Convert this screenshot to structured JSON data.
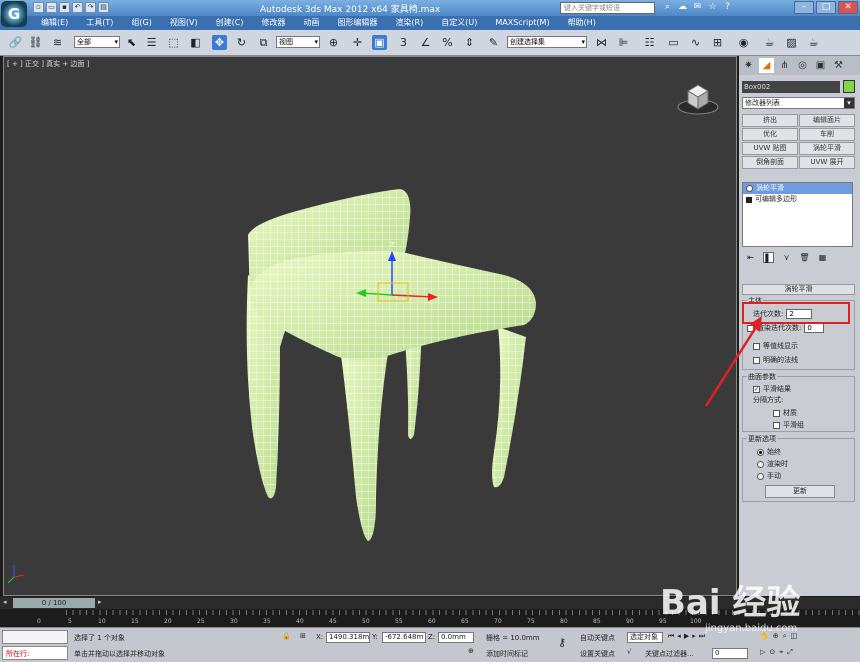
{
  "title": "Autodesk 3ds Max  2012 x64    家具椅.max",
  "search_placeholder": "键入关键字或短语",
  "menu": [
    "编辑(E)",
    "工具(T)",
    "组(G)",
    "视图(V)",
    "创建(C)",
    "修改器",
    "动画",
    "图形编辑器",
    "渲染(R)",
    "自定义(U)",
    "MAXScript(M)",
    "帮助(H)"
  ],
  "toolbar": {
    "selection_filter": "全部",
    "coord_system": "视图",
    "named_selection": "创建选择集"
  },
  "viewport": {
    "label": "[ + ] 正交 ] 真实 + 边面 ]",
    "gizmo_axis_z": "Z",
    "bg_color": "#3a3a3a",
    "mesh_color": "#d6f2a8"
  },
  "panel": {
    "object_name": "Box002",
    "modifier_list": "修改器列表",
    "modifier_buttons": [
      "挤出",
      "编辑面片",
      "优化",
      "车削",
      "UVW 贴图",
      "涡轮平滑",
      "倒角剖面",
      "UVW 展开"
    ],
    "stack": [
      "涡轮平滑",
      "可编辑多边形"
    ],
    "rollout_title": "涡轮平滑",
    "main_group": "主体",
    "iterations_label": "迭代次数:",
    "iterations_value": "2",
    "render_iters_label": "渲染迭代次数:",
    "render_iters_value": "0",
    "isoline": "等值线显示",
    "explicit_normals": "明确的法线",
    "surface_group": "曲面参数",
    "smooth_result": "平滑结果",
    "separate_by": "分隔方式:",
    "materials": "材质",
    "smoothing_groups": "平滑组",
    "update_group": "更新选项",
    "always": "始终",
    "when_render": "渲染时",
    "manual": "手动",
    "update_btn": "更新"
  },
  "timeline": {
    "frame": "0 / 100",
    "ticks": [
      "0",
      "5",
      "10",
      "15",
      "20",
      "25",
      "30",
      "35",
      "40",
      "45",
      "50",
      "55",
      "60",
      "65",
      "70",
      "75",
      "80",
      "85",
      "90",
      "95",
      "100"
    ]
  },
  "status": {
    "selection": "选择了 1 个对象",
    "prompt": "单击并拖动以选择并移动对象",
    "maxscript": "所在行:",
    "x_label": "X:",
    "x_value": "1490.318m",
    "y_label": "Y:",
    "y_value": "-672.648m",
    "z_label": "Z:",
    "z_value": "0.0mm",
    "grid": "栅格 = 10.0mm",
    "add_time_tag": "添加时间标记",
    "auto_key": "自动关键点",
    "set_key": "设置关键点",
    "selected": "选定对象",
    "key_filters": "关键点过滤器...",
    "frame_field": "0"
  },
  "watermark": "Bai 经验",
  "watermark_sub": "jingyan.baidu.com"
}
